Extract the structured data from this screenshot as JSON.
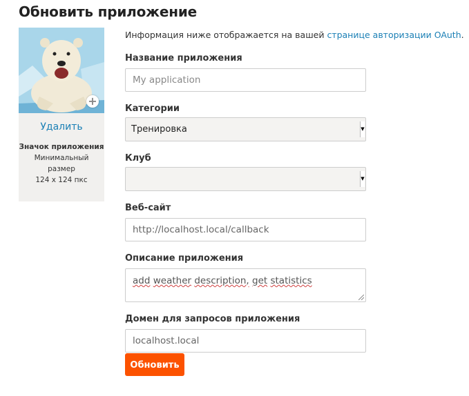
{
  "page": {
    "title": "Обновить приложение"
  },
  "icon_panel": {
    "delete_label": "Удалить",
    "caption_title": "Значок приложения",
    "caption_line1": "Минимальный",
    "caption_line2": "размер",
    "caption_line3": "124 x 124 пкс"
  },
  "info": {
    "text": "Информация ниже отображается на вашей ",
    "link": "странице авторизации OAuth",
    "suffix": "."
  },
  "form": {
    "name_label": "Название приложения",
    "name_placeholder": "My application",
    "category_label": "Категории",
    "category_value": "Тренировка",
    "club_label": "Клуб",
    "club_value": "",
    "website_label": "Веб-сайт",
    "website_value": "http://localhost.local/callback",
    "description_label": "Описание приложения",
    "description_part1": "add",
    "description_part2": "weather",
    "description_part3": "description,",
    "description_part4": "get",
    "description_part5": "statistics",
    "domain_label": "Домен для запросов приложения",
    "domain_value": "localhost.local",
    "submit_label": "Обновить"
  },
  "colors": {
    "accent": "#fc5200",
    "link": "#1a7fb5"
  }
}
